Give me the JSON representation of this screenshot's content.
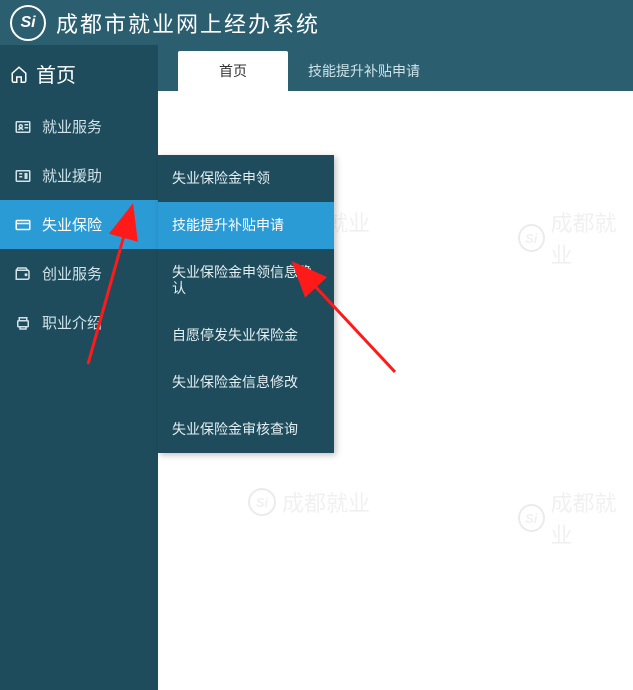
{
  "header": {
    "logo_text": "Si",
    "title": "成都市就业网上经办系统"
  },
  "sidebar": {
    "home_label": "首页",
    "items": [
      {
        "label": "就业服务"
      },
      {
        "label": "就业援助"
      },
      {
        "label": "失业保险",
        "active": true
      },
      {
        "label": "创业服务"
      },
      {
        "label": "职业介绍"
      }
    ]
  },
  "tabs": [
    {
      "label": "首页",
      "active": true
    },
    {
      "label": "技能提升补贴申请",
      "active": false
    }
  ],
  "submenu": {
    "items": [
      {
        "label": "失业保险金申领"
      },
      {
        "label": "技能提升补贴申请",
        "highlight": true
      },
      {
        "label": "失业保险金申领信息确认"
      },
      {
        "label": "自愿停发失业保险金"
      },
      {
        "label": "失业保险金信息修改"
      },
      {
        "label": "失业保险金审核查询"
      }
    ]
  },
  "watermark": {
    "badge": "Si",
    "text": "成都就业"
  }
}
